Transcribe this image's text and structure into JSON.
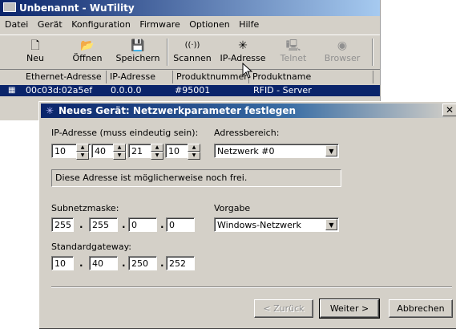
{
  "main_window": {
    "title": "Unbenannt - WuTility",
    "menu": [
      "Datei",
      "Gerät",
      "Konfiguration",
      "Firmware",
      "Optionen",
      "Hilfe"
    ],
    "toolbar": [
      {
        "label": "Neu",
        "icon": "new-document-icon",
        "glyph": "🗋",
        "enabled": true
      },
      {
        "label": "Öffnen",
        "icon": "open-folder-icon",
        "glyph": "📂",
        "enabled": true
      },
      {
        "label": "Speichern",
        "icon": "save-icon",
        "glyph": "💾",
        "enabled": true
      },
      {
        "label": "Scannen",
        "icon": "scan-icon",
        "glyph": "((·))",
        "enabled": true
      },
      {
        "label": "IP-Adresse",
        "icon": "ip-address-icon",
        "glyph": "✳",
        "enabled": true
      },
      {
        "label": "Telnet",
        "icon": "telnet-icon",
        "glyph": "🖳",
        "enabled": false
      },
      {
        "label": "Browser",
        "icon": "browser-icon",
        "glyph": "◉",
        "enabled": false
      }
    ],
    "columns": [
      "Ethernet-Adresse",
      "IP-Adresse",
      "Produktnummer",
      "Produktname"
    ],
    "row": {
      "mac": "00c03d:02a5ef",
      "ip": "0.0.0.0",
      "product_number": "#95001",
      "product_name": "RFID - Server"
    }
  },
  "dialog": {
    "title": "Neues Gerät: Netzwerkparameter festlegen",
    "ip_label": "IP-Adresse (muss eindeutig sein):",
    "ip": [
      "10",
      "40",
      "21",
      "10"
    ],
    "range_label": "Adressbereich:",
    "range_value": "Netzwerk #0",
    "info_text": "Diese Adresse ist möglicherweise noch frei.",
    "subnet_label": "Subnetzmaske:",
    "subnet": [
      "255",
      "255",
      "0",
      "0"
    ],
    "preset_label": "Vorgabe",
    "preset_value": "Windows-Netzwerk",
    "gateway_label": "Standardgateway:",
    "gateway": [
      "10",
      "40",
      "250",
      "252"
    ],
    "dot": ".",
    "back_label": "< Zurück",
    "next_label": "Weiter >",
    "cancel_label": "Abbrechen"
  }
}
